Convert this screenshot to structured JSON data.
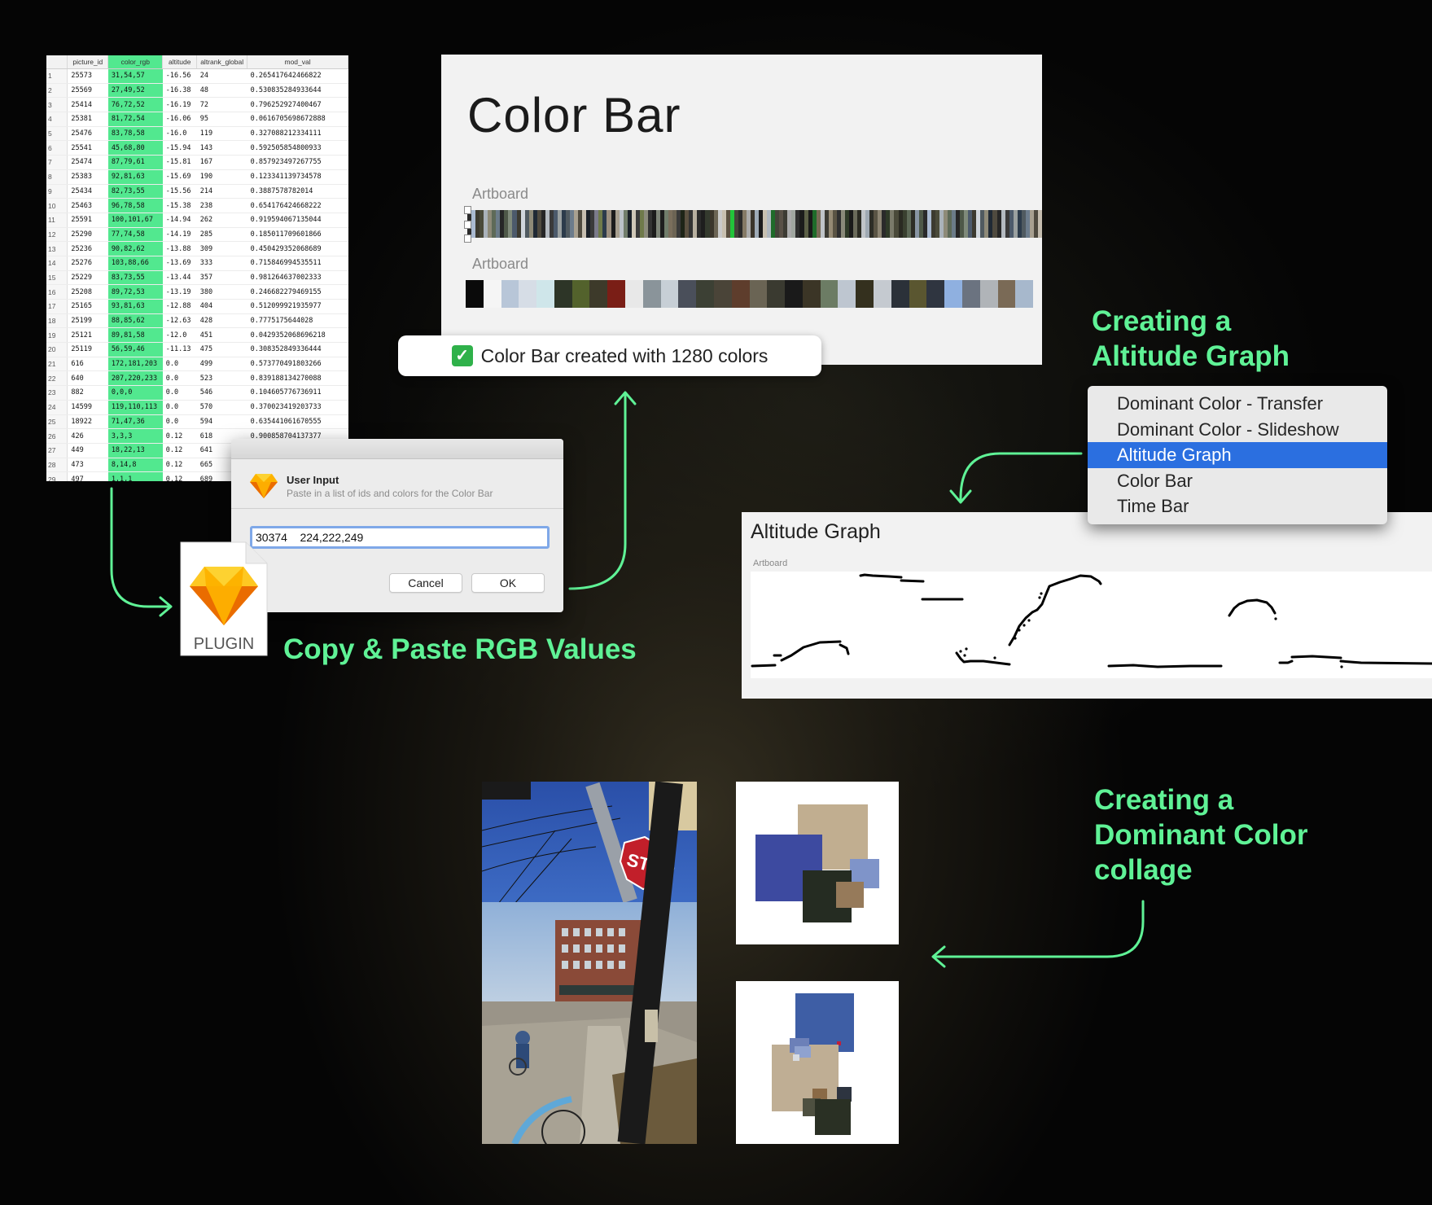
{
  "spreadsheet": {
    "columns": [
      "",
      "picture_id",
      "color_rgb",
      "altitude",
      "altrank_global",
      "mod_val"
    ],
    "rows": [
      [
        "1",
        "25573",
        "31,54,57",
        "-16.56",
        "24",
        "0.265417642466822"
      ],
      [
        "2",
        "25569",
        "27,49,52",
        "-16.38",
        "48",
        "0.530835284933644"
      ],
      [
        "3",
        "25414",
        "76,72,52",
        "-16.19",
        "72",
        "0.796252927400467"
      ],
      [
        "4",
        "25381",
        "81,72,54",
        "-16.06",
        "95",
        "0.0616705698672888"
      ],
      [
        "5",
        "25476",
        "83,78,58",
        "-16.0",
        "119",
        "0.327088212334111"
      ],
      [
        "6",
        "25541",
        "45,68,80",
        "-15.94",
        "143",
        "0.592505854800933"
      ],
      [
        "7",
        "25474",
        "87,79,61",
        "-15.81",
        "167",
        "0.857923497267755"
      ],
      [
        "8",
        "25383",
        "92,81,63",
        "-15.69",
        "190",
        "0.123341139734578"
      ],
      [
        "9",
        "25434",
        "82,73,55",
        "-15.56",
        "214",
        "0.3887578782014"
      ],
      [
        "10",
        "25463",
        "96,78,58",
        "-15.38",
        "238",
        "0.654176424668222"
      ],
      [
        "11",
        "25591",
        "100,101,67",
        "-14.94",
        "262",
        "0.919594067135044"
      ],
      [
        "12",
        "25290",
        "77,74,58",
        "-14.19",
        "285",
        "0.185011709601866"
      ],
      [
        "13",
        "25236",
        "90,82,62",
        "-13.88",
        "309",
        "0.450429352068689"
      ],
      [
        "14",
        "25276",
        "103,88,66",
        "-13.69",
        "333",
        "0.715846994535511"
      ],
      [
        "15",
        "25229",
        "83,73,55",
        "-13.44",
        "357",
        "0.981264637002333"
      ],
      [
        "16",
        "25208",
        "89,72,53",
        "-13.19",
        "380",
        "0.246682279469155"
      ],
      [
        "17",
        "25165",
        "93,81,63",
        "-12.88",
        "404",
        "0.512099921935977"
      ],
      [
        "18",
        "25199",
        "88,85,62",
        "-12.63",
        "428",
        "0.7775175644028"
      ],
      [
        "19",
        "25121",
        "89,81,58",
        "-12.0",
        "451",
        "0.0429352068696218"
      ],
      [
        "20",
        "25119",
        "56,59,46",
        "-11.13",
        "475",
        "0.308352849336444"
      ],
      [
        "21",
        "616",
        "172,181,203",
        "0.0",
        "499",
        "0.573770491803266"
      ],
      [
        "22",
        "640",
        "207,220,233",
        "0.0",
        "523",
        "0.839188134270088"
      ],
      [
        "23",
        "882",
        "0,0,0",
        "0.0",
        "546",
        "0.104605776736911"
      ],
      [
        "24",
        "14599",
        "119,110,113",
        "0.0",
        "570",
        "0.370023419203733"
      ],
      [
        "25",
        "18922",
        "71,47,36",
        "0.0",
        "594",
        "0.635441061670555"
      ],
      [
        "26",
        "426",
        "3,3,3",
        "0.12",
        "618",
        "0.900858704137377"
      ],
      [
        "27",
        "449",
        "18,22,13",
        "0.12",
        "641",
        ""
      ],
      [
        "28",
        "473",
        "8,14,8",
        "0.12",
        "665",
        ""
      ],
      [
        "29",
        "497",
        "1,1,1",
        "0.12",
        "689",
        ""
      ]
    ]
  },
  "color_bar": {
    "title": "Color Bar",
    "artboard_label_1": "Artboard",
    "artboard_label_2": "Artboard",
    "stripe_colors": [
      "#2a2a2a",
      "#8a8a7a",
      "#1b1b1b",
      "#c9c9c9",
      "#3a3a3a",
      "#7b7b8a",
      "#4c5a6b",
      "#a9b9d0",
      "#2f3a28",
      "#5b5f46",
      "#c8c0b0",
      "#1d2417",
      "#6f7a4a",
      "#9aa0a0",
      "#3c3a30",
      "#7a7a6a",
      "#1a1a1a",
      "#b0b8c0",
      "#5a5040",
      "#8b8b7b",
      "#2c3b4b",
      "#d0d6dc",
      "#4a4a3a",
      "#6a6a5a",
      "#1f6b2a",
      "#22c43a",
      "#333333",
      "#9c9080",
      "#505a60",
      "#aab2ba",
      "#2a2a22",
      "#776a55",
      "#44443a",
      "#b8b0a0",
      "#1c1c1c",
      "#6c7c8c",
      "#8e8a78",
      "#3a4030",
      "#c0c4c8",
      "#595046",
      "#2b2b2b",
      "#7d8478",
      "#a8a090",
      "#202a35",
      "#5e6a58",
      "#9fa9b3",
      "#3d3b33",
      "#857a66",
      "#1e1e1e",
      "#bcc2c8",
      "#4f4a3f",
      "#6b7b88",
      "#2d2d26",
      "#958a74",
      "#ababab",
      "#343a2e",
      "#717d6b",
      "#c6beb0",
      "#262626",
      "#8895a3",
      "#5a5444",
      "#a0a6a0",
      "#3b352b",
      "#7a6e5c",
      "#1a2028",
      "#b4bac0",
      "#4e5848",
      "#8c8472",
      "#2f2f2f",
      "#9eaab6",
      "#6c6454",
      "#cfc7b7",
      "#3a3a3a",
      "#7f8a7a"
    ],
    "swatch_colors": [
      "#0a0a0a",
      "#f5f5f5",
      "#b8c6d8",
      "#d6dde6",
      "#cfe6ea",
      "#2d3527",
      "#53622c",
      "#3d3a2a",
      "#7a1e16",
      "#e8e8e8",
      "#8a949a",
      "#c7cfd6",
      "#4a4f5a",
      "#3c4034",
      "#4a4438",
      "#5e3d2c",
      "#6a6454",
      "#3a3a30",
      "#1a1a1a",
      "#3b3526",
      "#6c7c64",
      "#bec6d0",
      "#34301e",
      "#c5cad0",
      "#2b3139",
      "#5a5630",
      "#2f3540",
      "#8fb0e0",
      "#6b7380",
      "#b0b4b8",
      "#7a6a56",
      "#a7b8cc"
    ]
  },
  "toast": {
    "check_glyph": "✓",
    "message": "Color Bar created with 1280 colors"
  },
  "dialog": {
    "title": "User Input",
    "subtitle": "Paste in a list of ids and colors for the Color Bar",
    "input_value": "30374    224,222,249",
    "cancel_label": "Cancel",
    "ok_label": "OK"
  },
  "plugin": {
    "label": "PLUGIN",
    "icon": "sketch-diamond-icon"
  },
  "captions": {
    "copy_paste": "Copy & Paste RGB Values",
    "altitude_line1": "Creating a",
    "altitude_line2": "Altitude Graph",
    "collage_line1": "Creating a",
    "collage_line2": "Dominant Color",
    "collage_line3": "collage"
  },
  "menu": {
    "items": [
      {
        "label": "Dominant Color - Transfer",
        "selected": false
      },
      {
        "label": "Dominant Color - Slideshow",
        "selected": false
      },
      {
        "label": "Altitude Graph",
        "selected": true
      },
      {
        "label": "Color Bar",
        "selected": false
      },
      {
        "label": "Time Bar",
        "selected": false
      }
    ]
  },
  "altitude_graph": {
    "title": "Altitude Graph",
    "artboard_label": "Artboard"
  },
  "photo": {
    "stop_sign_text": "STOP"
  },
  "colors": {
    "accent_green": "#5ff296",
    "menu_selection": "#2b6fe0",
    "sheet_highlight": "#52e88f"
  }
}
